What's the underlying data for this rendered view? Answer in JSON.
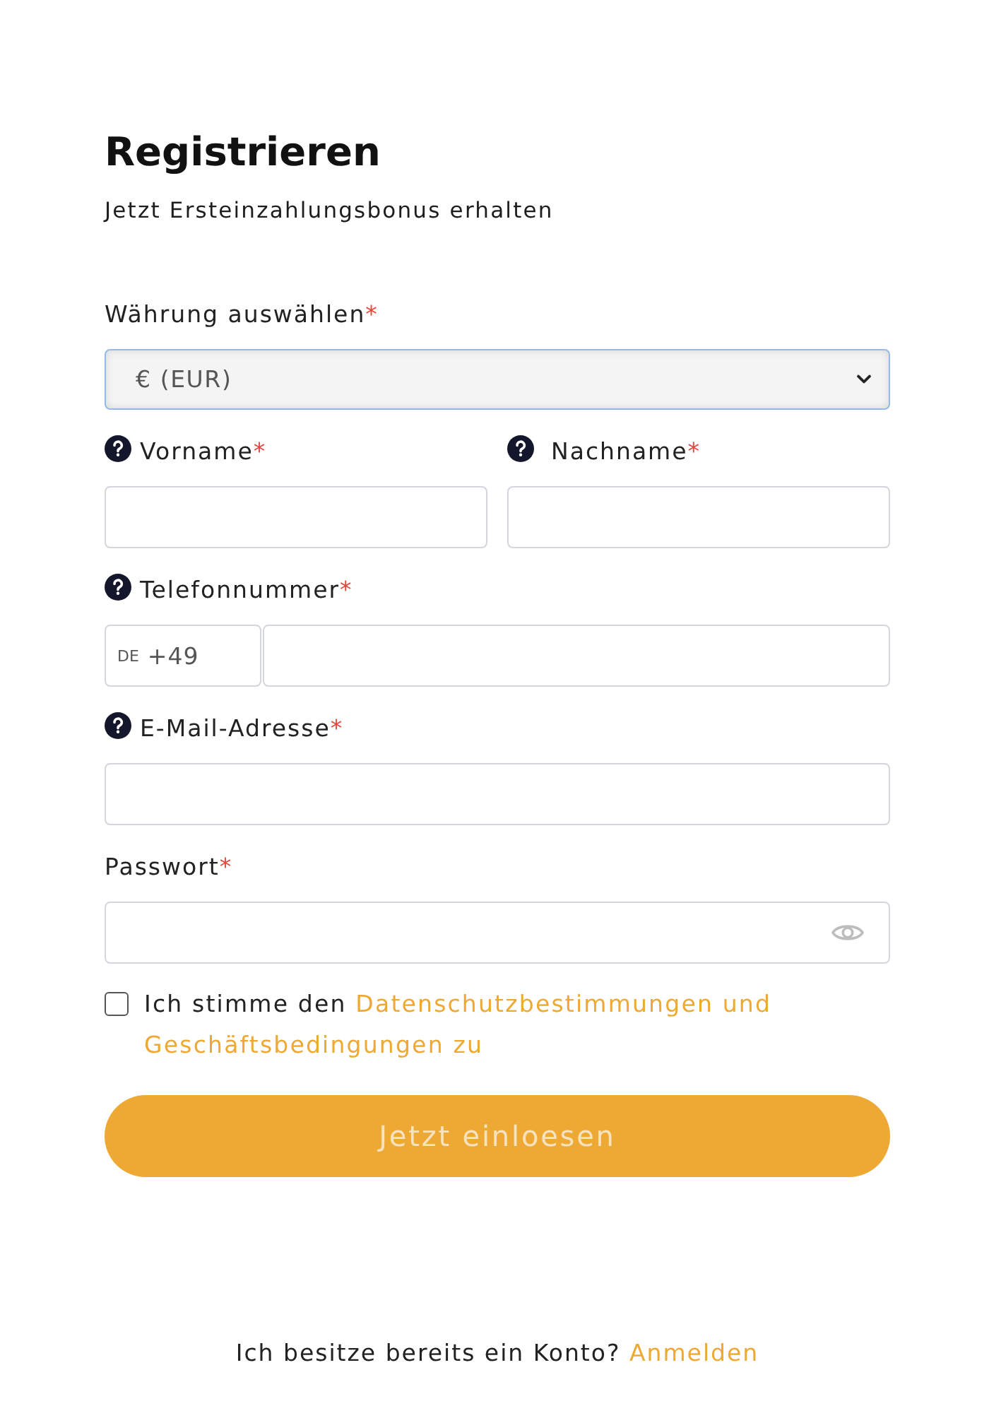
{
  "title": "Registrieren",
  "subtitle": "Jetzt Ersteinzahlungsbonus erhalten",
  "rows": [
    {
      "fields": [
        {
          "kind": "select",
          "label": "Währung auswählen",
          "required_mark": "*",
          "help": false,
          "value": "€ (EUR)",
          "focused": true
        }
      ]
    },
    {
      "fields": [
        {
          "kind": "text",
          "label": "Vorname",
          "required_mark": "*",
          "help": true
        },
        {
          "kind": "text",
          "label": "Nachname",
          "required_mark": "*",
          "help": true
        }
      ]
    },
    {
      "fields": [
        {
          "kind": "phone",
          "label": "Telefonnummer",
          "required_mark": "*",
          "help": true,
          "country": "DE",
          "dial_code": "+49"
        }
      ]
    },
    {
      "fields": [
        {
          "kind": "email",
          "label": "E-Mail-Adresse",
          "required_mark": "*",
          "help": true
        }
      ]
    },
    {
      "fields": [
        {
          "kind": "password",
          "label": "Passwort",
          "required_mark": "*",
          "help": false
        }
      ]
    }
  ],
  "consent": {
    "checked": false,
    "text": "Ich stimme den",
    "link_lines": [
      "Datenschutzbestimmungen und",
      "Geschäftsbedingungen zu"
    ]
  },
  "submit": {
    "label": "Jetzt einloesen",
    "disabled": true
  },
  "footer": {
    "text": "Ich besitze bereits ein Konto?",
    "link": "Anmelden"
  }
}
